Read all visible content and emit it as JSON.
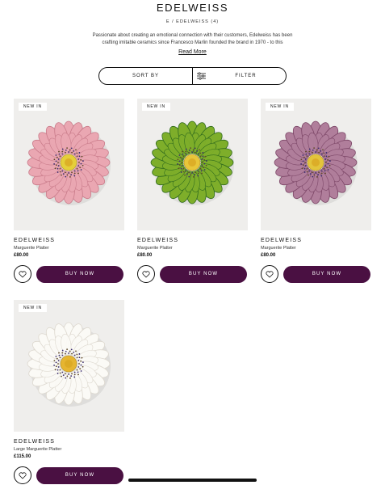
{
  "header": {
    "brand": "EDELWEISS",
    "breadcrumb": "E / EDELWEISS (4)",
    "description": "Passionate about creating an emotional connection with their customers, Edelweiss has been crafting imitable ceramics since Francesco Marlin founded the brand in 1970 - to this",
    "read_more": "Read More"
  },
  "controls": {
    "sort_label": "SORT BY",
    "filter_label": "FILTER"
  },
  "products": [
    {
      "badge": "NEW IN",
      "brand": "EDELWEISS",
      "name": "Marguerite Platter",
      "price": "£80.00",
      "buy_label": "BUY NOW",
      "petal_color": "#eaa7b2",
      "petal_edge": "#c97b8a",
      "center_color": "#e5cf3a",
      "image_icon": "pink-daisy-platter"
    },
    {
      "badge": "NEW IN",
      "brand": "EDELWEISS",
      "name": "Marguerite Platter",
      "price": "£80.00",
      "buy_label": "BUY NOW",
      "petal_color": "#7eae2a",
      "petal_edge": "#2f6a1d",
      "center_color": "#e8c63a",
      "image_icon": "green-daisy-platter"
    },
    {
      "badge": "NEW IN",
      "brand": "EDELWEISS",
      "name": "Marguerite Platter",
      "price": "£80.00",
      "buy_label": "BUY NOW",
      "petal_color": "#b07e9b",
      "petal_edge": "#7b4566",
      "center_color": "#e3c43c",
      "image_icon": "purple-daisy-platter"
    },
    {
      "badge": "NEW IN",
      "brand": "EDELWEISS",
      "name": "Large Marguerite Platter",
      "price": "£115.00",
      "buy_label": "BUY NOW",
      "petal_color": "#fbfaf6",
      "petal_edge": "#ddd8cf",
      "center_color": "#e6b531",
      "image_icon": "white-daisy-platter"
    }
  ]
}
